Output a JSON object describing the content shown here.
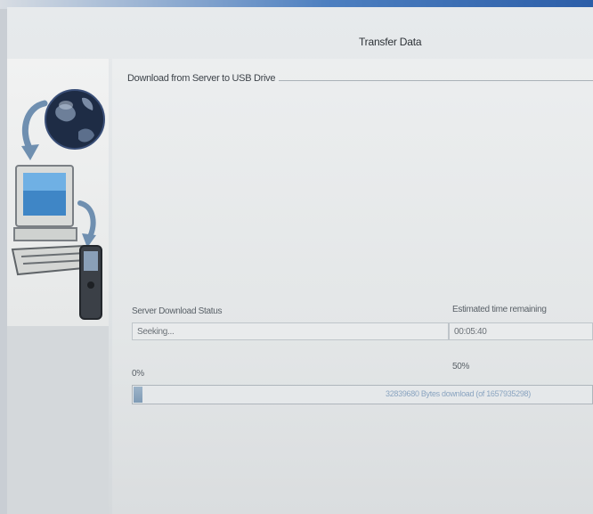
{
  "window": {
    "title": "Transfer Data"
  },
  "group": {
    "label": "Download from Server to USB Drive"
  },
  "status": {
    "label": "Server Download Status",
    "value": "Seeking..."
  },
  "time_remaining": {
    "label": "Estimated time remaining",
    "value": "00:05:40"
  },
  "progress": {
    "start_label": "0%",
    "mid_label": "50%",
    "fraction": 0.02,
    "text": "32839680 Bytes download (of 1657935298)"
  },
  "colors": {
    "accent": "#7f9bb5",
    "window_bg": "#e3e6e7"
  },
  "icons": [
    "globe-icon",
    "computer-icon",
    "transfer-arrow-icon",
    "handheld-scan-tool-icon"
  ]
}
